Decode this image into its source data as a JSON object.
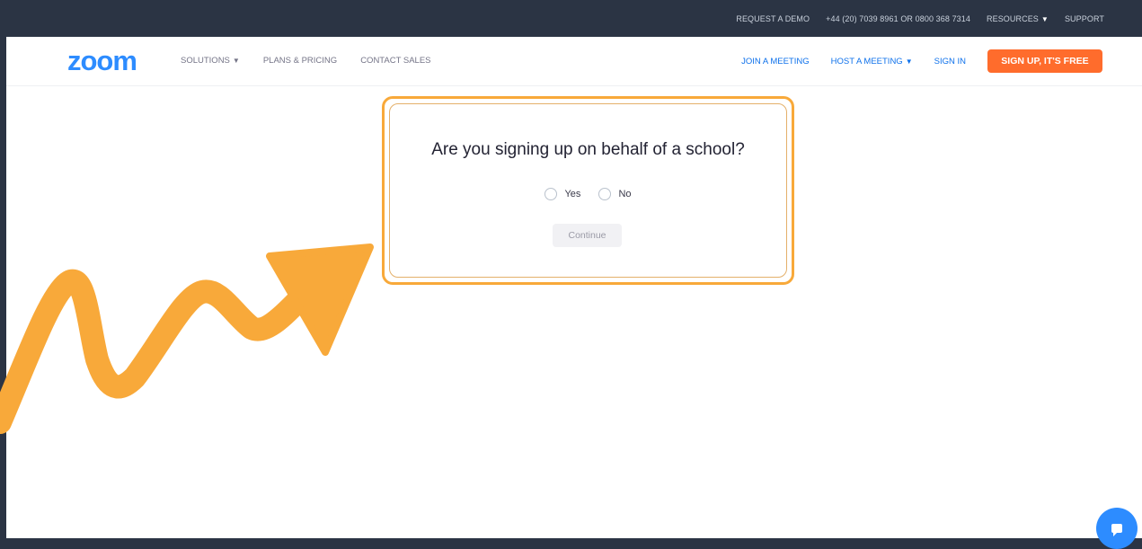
{
  "topbar": {
    "request_demo": "REQUEST A DEMO",
    "phone": "+44 (20) 7039 8961 OR 0800 368 7314",
    "resources": "RESOURCES",
    "support": "SUPPORT"
  },
  "navbar": {
    "logo": "zoom",
    "solutions": "SOLUTIONS",
    "plans_pricing": "PLANS & PRICING",
    "contact_sales": "CONTACT SALES",
    "join_meeting": "JOIN A MEETING",
    "host_meeting": "HOST A MEETING",
    "sign_in": "SIGN IN",
    "sign_up": "SIGN UP, IT'S FREE"
  },
  "dialog": {
    "question": "Are you signing up on behalf of a school?",
    "option_yes": "Yes",
    "option_no": "No",
    "continue_label": "Continue"
  },
  "colors": {
    "frame": "#2b3444",
    "brand_blue": "#2d8cff",
    "signup_orange": "#ff6c2c",
    "highlight_orange": "#f8a93a"
  },
  "icons": {
    "dropdown": "caret-down-icon",
    "chat": "chat-bubble-icon",
    "annotation": "arrow-annotation"
  }
}
